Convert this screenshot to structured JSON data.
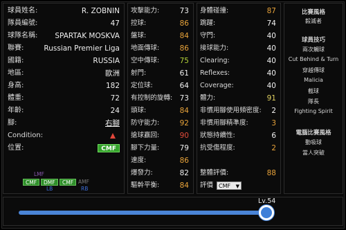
{
  "profile": {
    "rows": [
      {
        "label": "球員姓名:",
        "value": "R. ZOBNIN"
      },
      {
        "label": "隊員編號:",
        "value": "47"
      },
      {
        "label": "球隊名稱:",
        "value": "SPARTAK MOSKVA"
      },
      {
        "label": "聯賽:",
        "value": "Russian Premier Liga"
      },
      {
        "label": "國籍:",
        "value": "RUSSIA"
      },
      {
        "label": "地區:",
        "value": "歐洲"
      },
      {
        "label": "身高:",
        "value": "182"
      },
      {
        "label": "體重:",
        "value": "72"
      },
      {
        "label": "年齡:",
        "value": "24"
      },
      {
        "label": "腳:",
        "value": "右腳"
      }
    ],
    "condition_label": "Condition:",
    "condition_icon": "condition-arrow-up-icon",
    "position_label": "位置:",
    "position": "CMF",
    "position_chart": {
      "LMF": "LMF",
      "CMF_left": "CMF",
      "DMF": "DMF",
      "CMF_center": "CMF",
      "AMF": "AMF",
      "LB": "LB",
      "RB": "RB"
    }
  },
  "stats1": [
    {
      "label": "攻擊能力:",
      "value": "73"
    },
    {
      "label": "控球:",
      "value": "86"
    },
    {
      "label": "盤球:",
      "value": "84"
    },
    {
      "label": "地面傳球:",
      "value": "86"
    },
    {
      "label": "空中傳球:",
      "value": "75"
    },
    {
      "label": "射門:",
      "value": "61"
    },
    {
      "label": "定位球:",
      "value": "64"
    },
    {
      "label": "有控制的旋轉:",
      "value": "73"
    },
    {
      "label": "頭球:",
      "value": "84"
    },
    {
      "label": "防守能力:",
      "value": "92"
    },
    {
      "label": "搶球贏回:",
      "value": "90"
    },
    {
      "label": "腳下力量:",
      "value": "79"
    },
    {
      "label": "速度:",
      "value": "86"
    },
    {
      "label": "爆發力:",
      "value": "82"
    },
    {
      "label": "驅幹平衡:",
      "value": "84"
    }
  ],
  "stats2": [
    {
      "label": "身體碰撞:",
      "value": "87"
    },
    {
      "label": "跳躍:",
      "value": "74"
    },
    {
      "label": "守門:",
      "value": "40"
    },
    {
      "label": "接球能力:",
      "value": "40"
    },
    {
      "label": "Clearing:",
      "value": "40"
    },
    {
      "label": "Reflexes:",
      "value": "40"
    },
    {
      "label": "Coverage:",
      "value": "40"
    },
    {
      "label": "體力:",
      "value": "91"
    },
    {
      "label": "非慣用腳使用頻密度:",
      "value": "2"
    },
    {
      "label": "非慣用腳精準度:",
      "value": "3"
    },
    {
      "label": "狀態持續性:",
      "value": "6"
    },
    {
      "label": "抗受傷程度:",
      "value": "2"
    }
  ],
  "rating": {
    "label": "整體評價:",
    "value": "88"
  },
  "evaluation": {
    "label": "評價",
    "selected": "CMF"
  },
  "sidebar": {
    "title1": "比賽風格",
    "style": "毅滅者",
    "title2": "球員技巧",
    "skills": [
      "兩次觸球",
      "Cut Behind & Turn",
      "穿越傳球",
      "Malicia",
      "截球",
      "隊長",
      "Fighting Spirit"
    ],
    "title3": "電腦比賽風格",
    "ai_styles": [
      "動吸球",
      "當人突破"
    ]
  },
  "level": {
    "label": "Lv.54",
    "fraction": 1.0
  }
}
